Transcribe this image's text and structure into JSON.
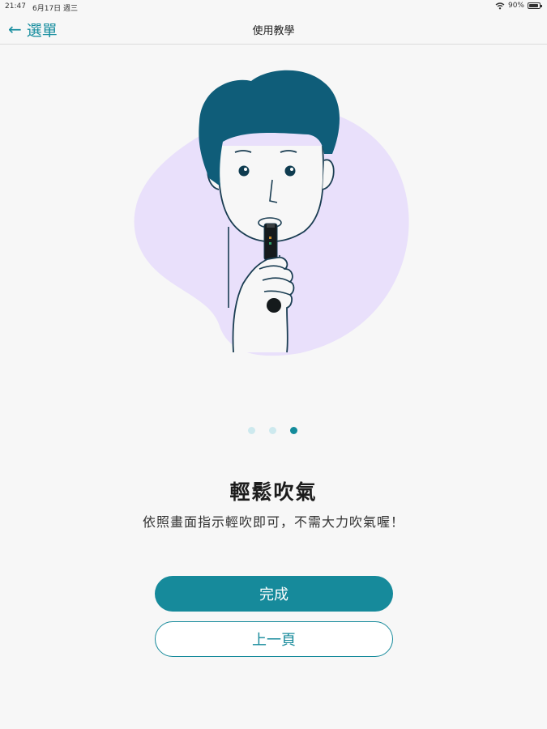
{
  "status_bar": {
    "time": "21:47",
    "date": "6月17日 週三",
    "battery": "90%",
    "battery_level": 0.9,
    "icons": [
      "wifi-icon",
      "battery-icon"
    ]
  },
  "nav": {
    "back_label": "選單",
    "back_icon": "arrow-left-icon",
    "title": "使用教學"
  },
  "illustration": {
    "icon": "man-blowing-breathalyzer-illustration",
    "colors": {
      "background_blob": "#e9e0fb",
      "hair": "#0f5d79",
      "line": "#1a3d52"
    }
  },
  "pager": {
    "total": 3,
    "current": 3
  },
  "content": {
    "headline": "輕鬆吹氣",
    "description": "依照畫面指示輕吹即可，不需大力吹氣喔！"
  },
  "buttons": {
    "done_label": "完成",
    "prev_label": "上一頁"
  },
  "colors": {
    "accent": "#168a9b",
    "dot_inactive": "#cde9ee"
  }
}
